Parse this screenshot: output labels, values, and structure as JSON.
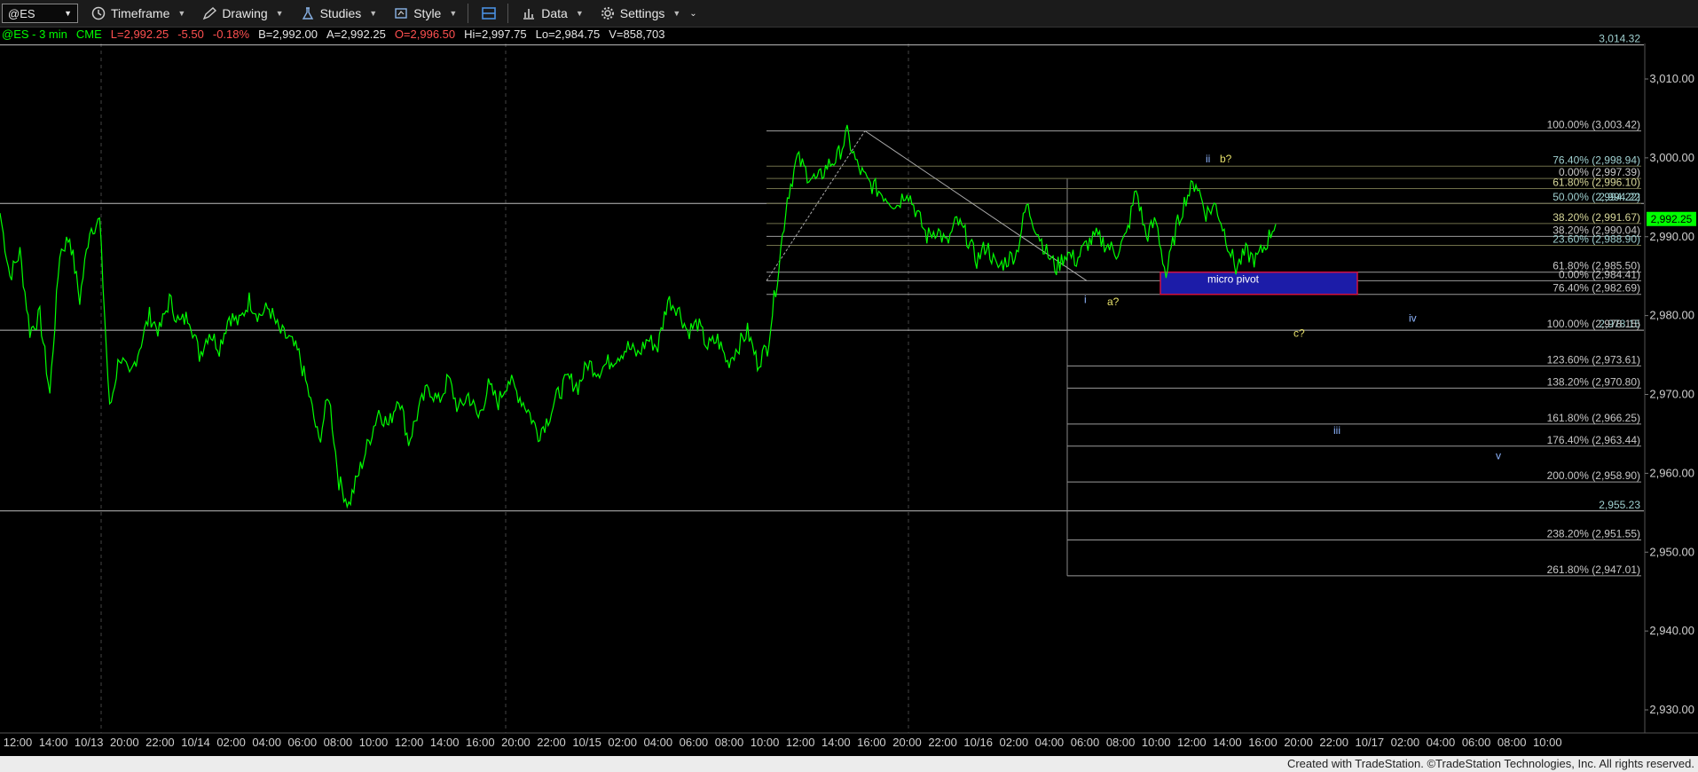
{
  "toolbar": {
    "symbol": "@ES",
    "items": [
      {
        "label": "Timeframe",
        "icon": "clock-icon"
      },
      {
        "label": "Drawing",
        "icon": "pencil-icon"
      },
      {
        "label": "Studies",
        "icon": "flask-icon"
      },
      {
        "label": "Style",
        "icon": "style-icon"
      },
      {
        "label": "",
        "icon": "layout-icon"
      },
      {
        "label": "Data",
        "icon": "data-icon"
      },
      {
        "label": "Settings",
        "icon": "gear-icon"
      }
    ]
  },
  "info": {
    "symbol_interval": "@ES - 3 min",
    "exchange": "CME",
    "last": "L=2,992.25",
    "change": "-5.50",
    "change_pct": "-0.18%",
    "bid": "B=2,992.00",
    "ask": "A=2,992.25",
    "open": "O=2,996.50",
    "high": "Hi=2,997.75",
    "low": "Lo=2,984.75",
    "volume": "V=858,703"
  },
  "colors": {
    "price": "#00ff00",
    "fib_white": "#c8c8c8",
    "fib_yellow": "#d8d89a",
    "fib_teal": "#9fd0d0",
    "pivot_fill": "#1c1ca8",
    "pivot_border": "#d01040",
    "label_blue": "#8eb5ff",
    "label_yellow": "#e6e06a",
    "last_price_bg": "#00ff00"
  },
  "chart_data": {
    "type": "line",
    "title": "",
    "xlabel": "",
    "ylabel": "",
    "ylim": [
      2926,
      3018
    ],
    "y_ticks": [
      2930,
      2940,
      2950,
      2960,
      2970,
      2980,
      2990,
      3000,
      3010
    ],
    "y_tick_labels": [
      "2,930.00",
      "2,940.00",
      "2,950.00",
      "2,960.00",
      "2,970.00",
      "2,980.00",
      "2,990.00",
      "3,000.00",
      "3,010.00"
    ],
    "x_tick_labels": [
      "12:00",
      "14:00",
      "10/13",
      "20:00",
      "22:00",
      "10/14",
      "02:00",
      "04:00",
      "06:00",
      "08:00",
      "10:00",
      "12:00",
      "14:00",
      "16:00",
      "20:00",
      "22:00",
      "10/15",
      "02:00",
      "04:00",
      "06:00",
      "08:00",
      "10:00",
      "12:00",
      "14:00",
      "16:00",
      "20:00",
      "22:00",
      "10/16",
      "02:00",
      "04:00",
      "06:00",
      "08:00",
      "10:00",
      "12:00",
      "14:00",
      "16:00",
      "20:00",
      "22:00",
      "10/17",
      "02:00",
      "04:00",
      "06:00",
      "08:00",
      "10:00"
    ],
    "last_price": "2,992.25",
    "horizontal_levels": [
      {
        "value": 3014.32,
        "label": "3,014.32"
      },
      {
        "value": 2994.22,
        "label": "2,994.22"
      },
      {
        "value": 2978.15,
        "label": "2,978.15"
      },
      {
        "value": 2955.23,
        "label": "2,955.23"
      }
    ],
    "fib_sets": [
      {
        "color": "white",
        "levels": [
          {
            "pct": "100.00%",
            "value": 3003.42,
            "label": "100.00% (3,003.42)"
          },
          {
            "pct": "38.20%",
            "value": 2990.04,
            "label": "38.20% (2,990.04)"
          },
          {
            "pct": "61.80%",
            "value": 2985.5,
            "label": "61.80% (2,985.50)"
          },
          {
            "pct": "0.00%",
            "value": 2984.41,
            "label": "0.00% (2,984.41)"
          },
          {
            "pct": "76.40%",
            "value": 2982.69,
            "label": "76.40% (2,982.69)"
          },
          {
            "pct": "100.00%",
            "value": 2978.15,
            "label": "100.00% (2,978.15)"
          },
          {
            "pct": "123.60%",
            "value": 2973.61,
            "label": "123.60% (2,973.61)"
          },
          {
            "pct": "138.20%",
            "value": 2970.8,
            "label": "138.20% (2,970.80)"
          },
          {
            "pct": "161.80%",
            "value": 2966.25,
            "label": "161.80% (2,966.25)"
          },
          {
            "pct": "176.40%",
            "value": 2963.44,
            "label": "176.40% (2,963.44)"
          },
          {
            "pct": "200.00%",
            "value": 2958.9,
            "label": "200.00% (2,958.90)"
          },
          {
            "pct": "238.20%",
            "value": 2951.55,
            "label": "238.20% (2,951.55)"
          },
          {
            "pct": "261.80%",
            "value": 2947.01,
            "label": "261.80% (2,947.01)"
          }
        ]
      },
      {
        "color": "teal",
        "levels": [
          {
            "pct": "76.40%",
            "value": 2998.94,
            "label": "76.40% (2,998.94)"
          },
          {
            "pct": "0.00%",
            "value": 2997.39,
            "label": "0.00% (2,997.39)"
          },
          {
            "pct": "61.80%",
            "value": 2996.1,
            "label": "61.80% (2,996.10)"
          },
          {
            "pct": "50.00%",
            "value": 2994.22,
            "label": "50.00% (2,994.22)"
          },
          {
            "pct": "38.20%",
            "value": 2991.67,
            "label": "38.20% (2,991.67)"
          },
          {
            "pct": "23.60%",
            "value": 2988.9,
            "label": "23.60% (2,988.90)"
          }
        ]
      }
    ],
    "pivot_zone": {
      "label": "micro pivot",
      "top": 2985.5,
      "bottom": 2982.69
    },
    "wave_labels": [
      {
        "text": "ii",
        "color": "blue"
      },
      {
        "text": "b?",
        "color": "yellow"
      },
      {
        "text": "i",
        "color": "blue"
      },
      {
        "text": "a?",
        "color": "yellow"
      },
      {
        "text": "iv",
        "color": "blue"
      },
      {
        "text": "c?",
        "color": "yellow"
      },
      {
        "text": "iii",
        "color": "blue"
      },
      {
        "text": "v",
        "color": "blue"
      }
    ],
    "series": [
      {
        "values": [
          2993,
          2985,
          2988,
          2978,
          2980,
          2970,
          2988,
          2990,
          2982,
          2991,
          2992,
          2968,
          2975,
          2972,
          2976,
          2980,
          2978,
          2982,
          2979,
          2980,
          2975,
          2978,
          2976,
          2980,
          2979,
          2982,
          2980,
          2981,
          2978,
          2977,
          2975,
          2970,
          2964,
          2970,
          2959,
          2956,
          2960,
          2964,
          2968,
          2966,
          2970,
          2964,
          2968,
          2971,
          2969,
          2972,
          2968,
          2970,
          2967,
          2971,
          2969,
          2972,
          2970,
          2968,
          2965,
          2967,
          2970,
          2972,
          2971,
          2974,
          2973,
          2974,
          2975,
          2976,
          2975,
          2977,
          2976,
          2982,
          2981,
          2978,
          2979,
          2976,
          2977,
          2974,
          2976,
          2978,
          2974,
          2976,
          2985,
          2995,
          3000,
          2998,
          2997,
          2999,
          3000,
          3003,
          2999,
          2997,
          2996,
          2995,
          2994,
          2996,
          2993,
          2990,
          2991,
          2989,
          2992,
          2990,
          2987,
          2989,
          2986,
          2987,
          2988,
          2994,
          2991,
          2988,
          2986,
          2988,
          2987,
          2989,
          2990,
          2989,
          2988,
          2990,
          2996,
          2990,
          2992,
          2985,
          2991,
          2995,
          2997,
          2993,
          2994,
          2990,
          2986,
          2988,
          2987,
          2989,
          2992
        ]
      }
    ]
  },
  "footer": {
    "text": "Created with TradeStation. ©TradeStation Technologies, Inc. All rights reserved."
  }
}
